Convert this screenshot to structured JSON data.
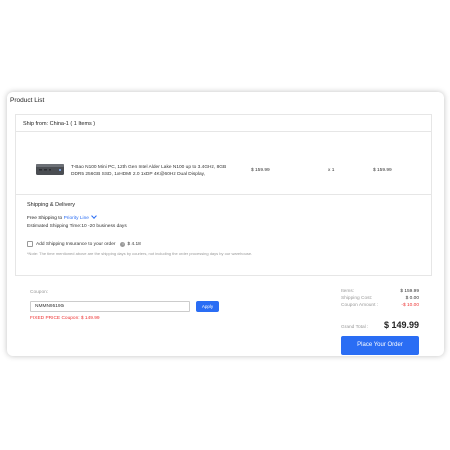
{
  "page": {
    "title": "Product List"
  },
  "shipment": {
    "header": "Ship from: China-1 ( 1 Items )",
    "product": {
      "title": "T-Bao N100 Mini PC, 12th Gen Intel Alder Lake N100 up to 3.4GHz, 8GB DDR5 256GB SSD, 1xHDMI 2.0 1xDP 4K@60Hz Dual Display,",
      "price": "$ 159.99",
      "qty": "x 1",
      "subtotal": "$ 159.99",
      "thumb_icon": "mini-pc-icon"
    },
    "shipping": {
      "section_title": "Shipping & Delivery",
      "free_label": "Free Shipping",
      "to_word": "to",
      "method": "Priority Line",
      "estimated": "Estimated Shipping Time:10 -20 business days",
      "insurance_label": "Add Shipping Insurance to your order",
      "insurance_price": "$ 4.18",
      "note": "*Note: The time mentioned above are the shipping days by couriers, not including the order processing days by our warehouse."
    }
  },
  "order": {
    "coupon_label": "Coupon:",
    "coupon_value": "NMMN95190i",
    "apply_label": "Apply",
    "fixed_price": "FIXED PRICE Coupon: $ 149.99",
    "items_label": "Items:",
    "items_value": "$ 159.99",
    "shipping_label": "Shipping Cost:",
    "shipping_value": "$ 0.00",
    "coupon_amount_label": "Coupon Amount :",
    "coupon_amount_value": "-$ 10.00",
    "grand_total_label": "Grand Total :",
    "grand_total_value": "$ 149.99",
    "place_order_label": "Place Your Order"
  },
  "colors": {
    "accent": "#2a6df4",
    "discount_red": "#e33333",
    "muted": "#999999"
  }
}
